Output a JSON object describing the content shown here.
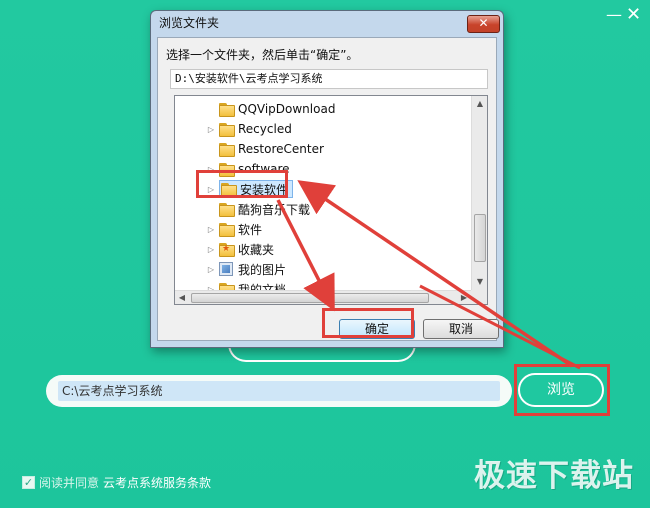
{
  "app": {
    "minimize_glyph": "—",
    "close_glyph": "✕",
    "install_path": "C:\\云考点学习系统",
    "browse_label": "浏览",
    "agree_prefix": "阅读并同意",
    "terms_link": "云考点系统服务条款",
    "agree_checked": true
  },
  "watermark": {
    "text": "极速下载站"
  },
  "dialog": {
    "title": "浏览文件夹",
    "close_glyph": "✕",
    "instruction": "选择一个文件夹，然后单击“确定”。",
    "selected_path": "D:\\安装软件\\云考点学习系统",
    "ok_label": "确定",
    "cancel_label": "取消",
    "tree_items": [
      {
        "label": "QQVipDownload",
        "has_children": false,
        "icon": "folder-icon"
      },
      {
        "label": "Recycled",
        "has_children": true,
        "icon": "folder-icon"
      },
      {
        "label": "RestoreCenter",
        "has_children": false,
        "icon": "folder-icon"
      },
      {
        "label": "software",
        "has_children": true,
        "icon": "folder-icon"
      },
      {
        "label": "安装软件",
        "has_children": true,
        "icon": "folder-icon",
        "selected": true
      },
      {
        "label": "酷狗音乐下载",
        "has_children": false,
        "icon": "folder-icon"
      },
      {
        "label": "软件",
        "has_children": true,
        "icon": "folder-icon"
      },
      {
        "label": "收藏夹",
        "has_children": true,
        "icon": "favorites-folder-icon"
      },
      {
        "label": "我的图片",
        "has_children": true,
        "icon": "pictures-folder-icon"
      },
      {
        "label": "我的文档",
        "has_children": true,
        "icon": "documents-folder-icon"
      }
    ]
  },
  "colors": {
    "background": "#1fc8a0",
    "highlight_red": "#e0403a",
    "selection": "#cde8ff"
  }
}
